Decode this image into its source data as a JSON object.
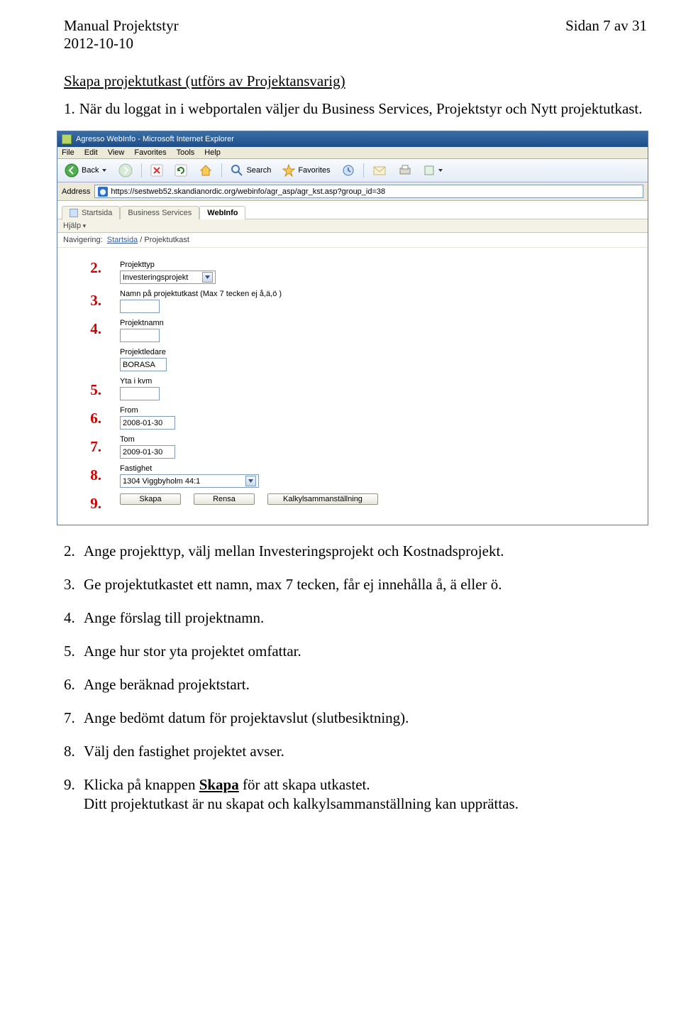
{
  "header": {
    "title": "Manual Projektstyr",
    "date": "2012-10-10",
    "page": "Sidan 7 av 31"
  },
  "section_title": "Skapa projektutkast (utförs av Projektansvarig)",
  "intro": {
    "num": "1.",
    "text": "När du loggat in i webportalen väljer du Business Services, Projektstyr och Nytt projektutkast."
  },
  "browser": {
    "window_title": "Agresso WebInfo - Microsoft Internet Explorer",
    "menus": [
      "File",
      "Edit",
      "View",
      "Favorites",
      "Tools",
      "Help"
    ],
    "back": "Back",
    "search": "Search",
    "favorites": "Favorites",
    "address_label": "Address",
    "url": "https://sestweb52.skandianordic.org/webinfo/agr_asp/agr_kst.asp?group_id=38",
    "tabs": {
      "start": "Startsida",
      "bs": "Business Services",
      "webinfo": "WebInfo"
    },
    "hjalp": "Hjälp",
    "nav_label": "Navigering:",
    "nav_start": "Startsida",
    "nav_sep": " / Projektutkast"
  },
  "form": {
    "n2": "2.",
    "n3": "3.",
    "n4": "4.",
    "n5": "5.",
    "n6": "6.",
    "n7": "7.",
    "n8": "8.",
    "n9": "9.",
    "projekttyp_label": "Projekttyp",
    "projekttyp_value": "Investeringsprojekt",
    "utkastnamn_label": "Namn på projektutkast (Max 7 tecken ej å,ä,ö )",
    "projektnamn_label": "Projektnamn",
    "projektledare_label": "Projektledare",
    "projektledare_value": "BORASA",
    "yta_label": "Yta i kvm",
    "from_label": "From",
    "from_value": "2008-01-30",
    "tom_label": "Tom",
    "tom_value": "2009-01-30",
    "fastighet_label": "Fastighet",
    "fastighet_value": "1304 Viggbyholm 44:1",
    "btn_skapa": "Skapa",
    "btn_rensa": "Rensa",
    "btn_kalkyl": "Kalkylsammanställning"
  },
  "steps": {
    "s2": {
      "n": "2.",
      "t": "Ange projekttyp, välj mellan Investeringsprojekt och Kostnadsprojekt."
    },
    "s3": {
      "n": "3.",
      "t": "Ge projektutkastet ett namn, max 7 tecken, får ej innehålla å, ä eller ö."
    },
    "s4": {
      "n": "4.",
      "t": "Ange förslag till projektnamn."
    },
    "s5": {
      "n": "5.",
      "t": "Ange hur stor yta projektet omfattar."
    },
    "s6": {
      "n": "6.",
      "t": "Ange beräknad projektstart."
    },
    "s7": {
      "n": "7.",
      "t": "Ange bedömt datum för projektavslut (slutbesiktning)."
    },
    "s8": {
      "n": "8.",
      "t": "Välj den fastighet projektet avser."
    },
    "s9_n": "9.",
    "s9_a": "Klicka på knappen ",
    "s9_b": "Skapa",
    "s9_c": " för att skapa utkastet.",
    "s9_final": "Ditt projektutkast är nu skapat och kalkylsammanställning kan upprättas."
  }
}
